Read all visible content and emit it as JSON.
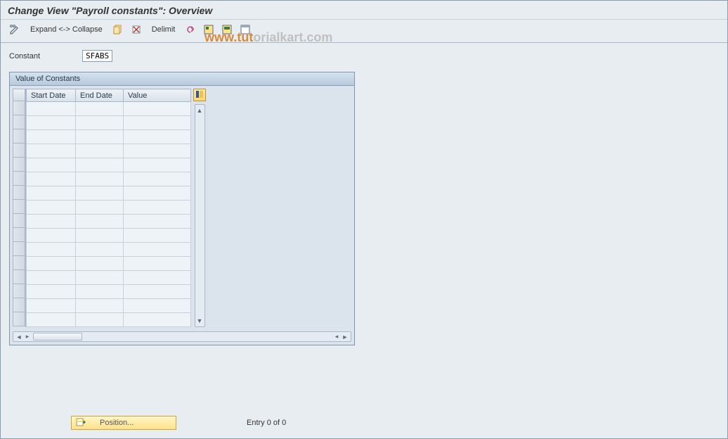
{
  "title": "Change View \"Payroll constants\": Overview",
  "toolbar": {
    "expand_collapse": "Expand <-> Collapse",
    "delimit": "Delimit"
  },
  "constant": {
    "label": "Constant",
    "value": "SFABS"
  },
  "panel": {
    "title": "Value of Constants",
    "columns": {
      "start": "Start Date",
      "end": "End Date",
      "value": "Value"
    },
    "rows": [
      {
        "start": "",
        "end": "",
        "value": ""
      },
      {
        "start": "",
        "end": "",
        "value": ""
      },
      {
        "start": "",
        "end": "",
        "value": ""
      },
      {
        "start": "",
        "end": "",
        "value": ""
      },
      {
        "start": "",
        "end": "",
        "value": ""
      },
      {
        "start": "",
        "end": "",
        "value": ""
      },
      {
        "start": "",
        "end": "",
        "value": ""
      },
      {
        "start": "",
        "end": "",
        "value": ""
      },
      {
        "start": "",
        "end": "",
        "value": ""
      },
      {
        "start": "",
        "end": "",
        "value": ""
      },
      {
        "start": "",
        "end": "",
        "value": ""
      },
      {
        "start": "",
        "end": "",
        "value": ""
      },
      {
        "start": "",
        "end": "",
        "value": ""
      },
      {
        "start": "",
        "end": "",
        "value": ""
      },
      {
        "start": "",
        "end": "",
        "value": ""
      },
      {
        "start": "",
        "end": "",
        "value": ""
      }
    ]
  },
  "footer": {
    "position_label": "Position...",
    "entry_text": "Entry 0 of 0"
  },
  "watermark_full": "www.tutorialkart.com"
}
